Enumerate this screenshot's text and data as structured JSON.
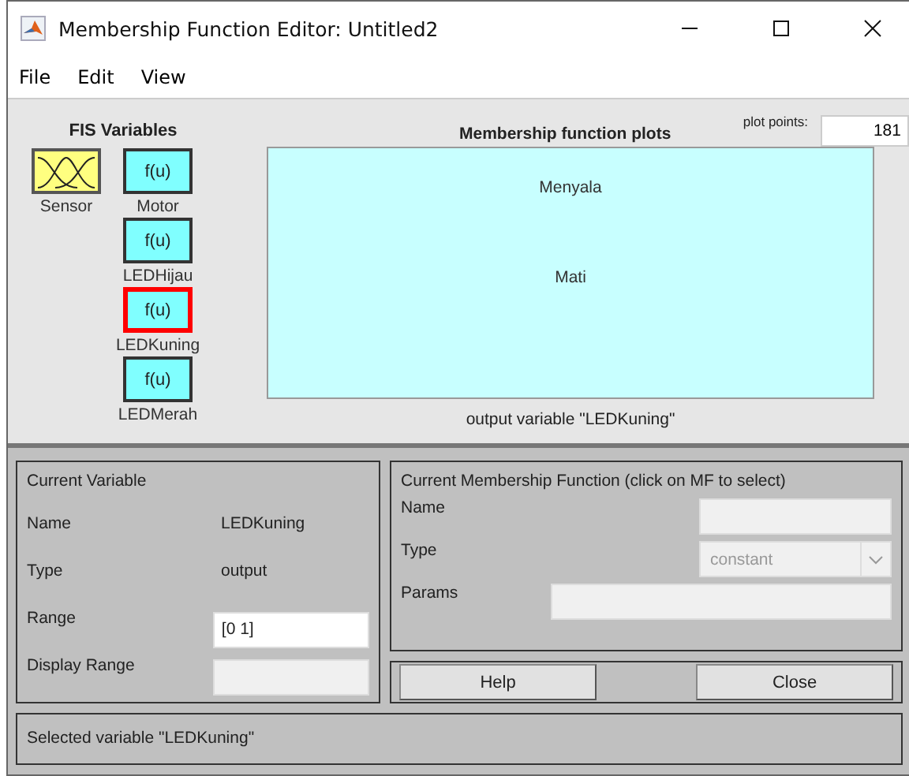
{
  "window": {
    "title": "Membership Function Editor: Untitled2"
  },
  "menu": [
    "File",
    "Edit",
    "View"
  ],
  "fis_variables": {
    "title": "FIS Variables",
    "variables": [
      {
        "name": "Sensor",
        "kind": "input",
        "selected": false
      },
      {
        "name": "Motor",
        "kind": "output",
        "selected": false,
        "box_label": "f(u)"
      },
      {
        "name": "LEDHijau",
        "kind": "output",
        "selected": false,
        "box_label": "f(u)"
      },
      {
        "name": "LEDKuning",
        "kind": "output",
        "selected": true,
        "box_label": "f(u)"
      },
      {
        "name": "LEDMerah",
        "kind": "output",
        "selected": false,
        "box_label": "f(u)"
      }
    ]
  },
  "plot": {
    "title": "Membership function plots",
    "plot_points_label": "plot points:",
    "plot_points": "181",
    "mf_labels": [
      "Menyala",
      "Mati"
    ],
    "caption": "output variable \"LEDKuning\""
  },
  "current_variable": {
    "title": "Current Variable",
    "name_label": "Name",
    "name": "LEDKuning",
    "type_label": "Type",
    "type": "output",
    "range_label": "Range",
    "range": "[0 1]",
    "display_range_label": "Display Range"
  },
  "current_mf": {
    "title": "Current Membership Function (click on MF to select)",
    "name_label": "Name",
    "type_label": "Type",
    "type": "constant",
    "type_disabled": true,
    "params_label": "Params"
  },
  "buttons": [
    "Help",
    "Close"
  ],
  "status": "Selected variable \"LEDKuning\""
}
